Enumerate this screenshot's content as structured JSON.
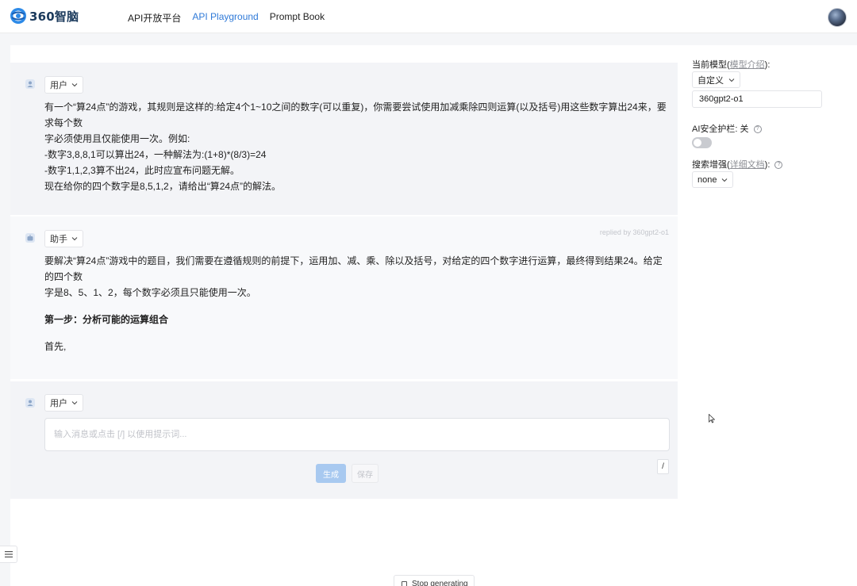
{
  "header": {
    "logo_text": "360智脑",
    "nav": [
      "API开放平台",
      "API Playground",
      "Prompt Book"
    ],
    "active_nav": "API Playground"
  },
  "user_message": {
    "role": "用户",
    "lines": [
      "有一个“算24点”的游戏，其规则是这样的:给定4个1~10之间的数字(可以重复)，你需要尝试使用加减乘除四则运算(以及括号)用这些数字算出24来，要求每个数",
      "字必须使用且仅能使用一次。例如:",
      "-数字3,8,8,1可以算出24，一种解法为:(1+8)*(8/3)=24",
      "-数字1,1,2,3算不出24，此时应宣布问题无解。",
      "现在给你的四个数字是8,5,1,2，请给出“算24点”的解法。"
    ]
  },
  "assistant_message": {
    "role": "助手",
    "replied_by": "replied by 360gpt2-o1",
    "paragraph1_line1": "要解决“算24点”游戏中的题目，我们需要在遵循规则的前提下，运用加、减、乘、除以及括号，对给定的四个数字进行运算，最终得到结果24。给定的四个数",
    "paragraph1_line2": "字是8、5、1、2，每个数字必须且只能使用一次。",
    "heading": "第一步：分析可能的运算组合",
    "paragraph2": "首先,"
  },
  "composer": {
    "role": "用户",
    "placeholder": "输入消息或点击 [/] 以使用提示词...",
    "generate_label": "生成",
    "save_label": "保存",
    "slash_label": "/"
  },
  "sidebar": {
    "model_label_prefix": "当前模型(",
    "model_link": "模型介绍",
    "model_label_suffix": "):",
    "model_type": "自定义",
    "model_name": "360gpt2-o1",
    "safety_label": "AI安全护栏: 关",
    "safety_enabled": false,
    "search_label_prefix": "搜索增强(",
    "search_link": "详细文档",
    "search_label_suffix": "):",
    "search_value": "none"
  },
  "stop_label": "Stop generating",
  "colors": {
    "accent": "#2f7ad8",
    "generate_button": "#a8c9f0"
  }
}
